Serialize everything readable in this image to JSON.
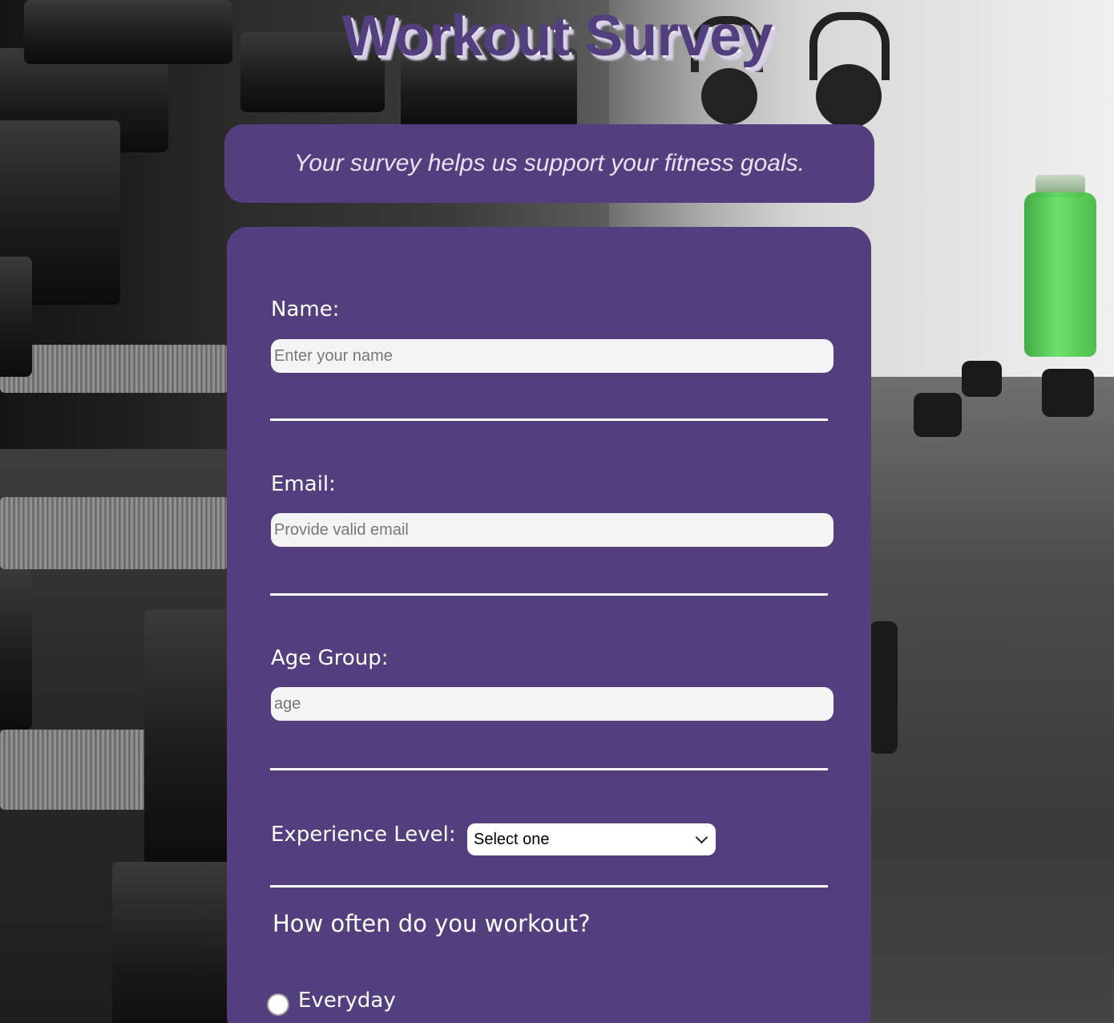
{
  "page": {
    "title": "Workout Survey",
    "subtitle": "Your survey helps us support your fitness goals.",
    "accent_color": "#533f7e"
  },
  "form": {
    "name": {
      "label": "Name:",
      "placeholder": "Enter your name",
      "value": ""
    },
    "email": {
      "label": "Email:",
      "placeholder": "Provide valid email",
      "value": ""
    },
    "age": {
      "label": "Age Group:",
      "placeholder": "age",
      "value": ""
    },
    "experience": {
      "label": "Experience Level:",
      "selected": "Select one"
    },
    "frequency": {
      "question": "How often do you workout?",
      "options": [
        {
          "label": "Everyday",
          "checked": false
        }
      ]
    }
  }
}
